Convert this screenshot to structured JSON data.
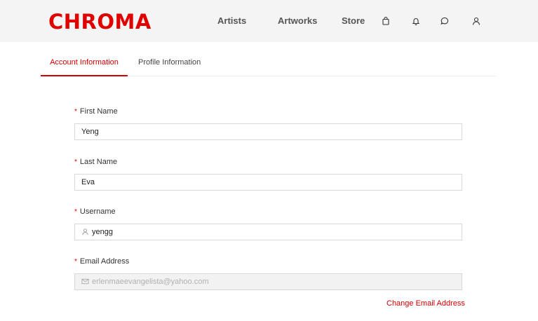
{
  "brand": {
    "name": "CHROMA",
    "color": "#e00000"
  },
  "nav": {
    "links": [
      "Artists",
      "Artworks",
      "Store"
    ],
    "icons": [
      "shopping-bag-icon",
      "bell-icon",
      "chat-icon",
      "user-icon"
    ]
  },
  "tabs": [
    {
      "label": "Account Information",
      "active": true
    },
    {
      "label": "Profile Information",
      "active": false
    }
  ],
  "form": {
    "required_mark": "*",
    "first_name": {
      "label": "First Name",
      "value": "Yeng"
    },
    "last_name": {
      "label": "Last Name",
      "value": "Eva"
    },
    "username": {
      "label": "Username",
      "value": "yengg",
      "icon": "user-icon"
    },
    "email": {
      "label": "Email Address",
      "value": "erlenmaeevangelista@yahoo.com",
      "icon": "mail-icon",
      "disabled": true
    }
  },
  "change_email_label": "Change Email Address",
  "colors": {
    "accent": "#d40000",
    "header_bg": "#f4f4f4"
  }
}
